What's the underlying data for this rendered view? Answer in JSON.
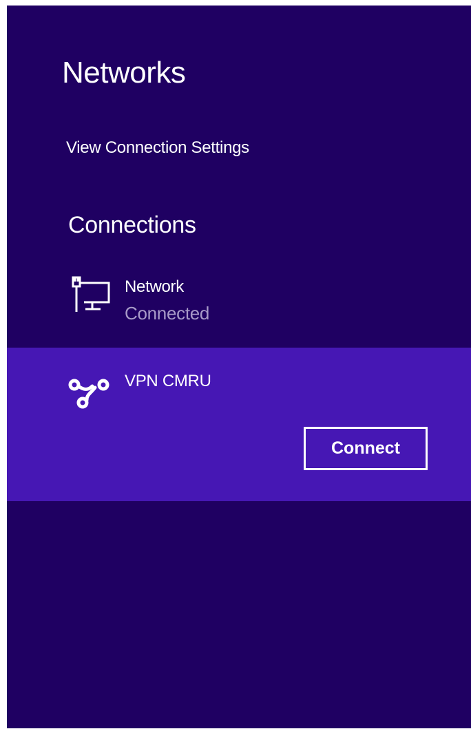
{
  "panel": {
    "title": "Networks",
    "view_settings_link": "View Connection Settings",
    "connections_heading": "Connections",
    "background_color": "#1f0062",
    "selected_color": "#4617b4"
  },
  "connections": [
    {
      "name": "Network",
      "status": "Connected",
      "icon": "wired-network-icon",
      "selected": false
    },
    {
      "name": "VPN CMRU",
      "icon": "vpn-icon",
      "selected": true,
      "action_label": "Connect"
    }
  ]
}
